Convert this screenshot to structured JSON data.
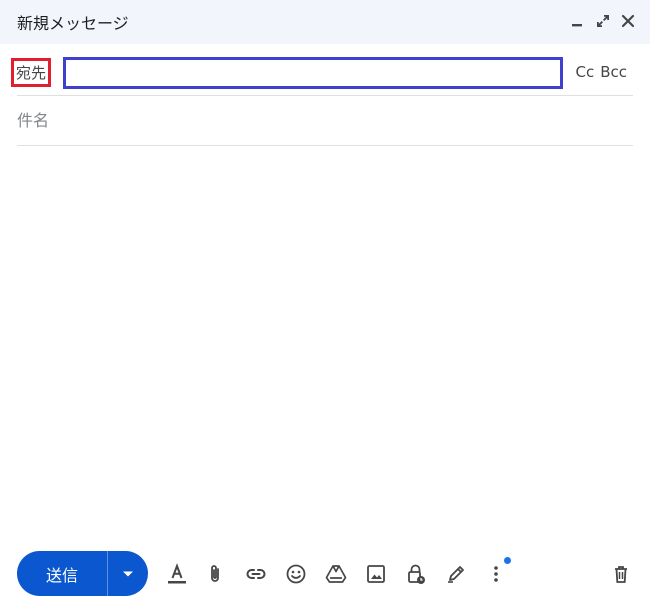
{
  "window": {
    "title": "新規メッセージ",
    "controls": [
      "minimize-icon",
      "expand-icon",
      "close-icon"
    ]
  },
  "recipients": {
    "to_label": "宛先",
    "to_value": "",
    "cc_label": "Cc",
    "bcc_label": "Bcc"
  },
  "subject": {
    "placeholder": "件名",
    "value": ""
  },
  "body": {
    "value": ""
  },
  "footer": {
    "send_label": "送信",
    "toolbar_icons": [
      "text-format-icon",
      "attach-icon",
      "link-icon",
      "emoji-icon",
      "drive-icon",
      "photo-icon",
      "confidential-mode-icon",
      "signature-icon",
      "more-options-icon",
      "trash-icon"
    ]
  },
  "colors": {
    "header_bg": "#f2f6fc",
    "send_button": "#0b57d0",
    "to_label_highlight": "#e0202e",
    "to_input_highlight": "#3f3fd0",
    "notification_dot": "#1a73e8",
    "icon": "#444746"
  }
}
